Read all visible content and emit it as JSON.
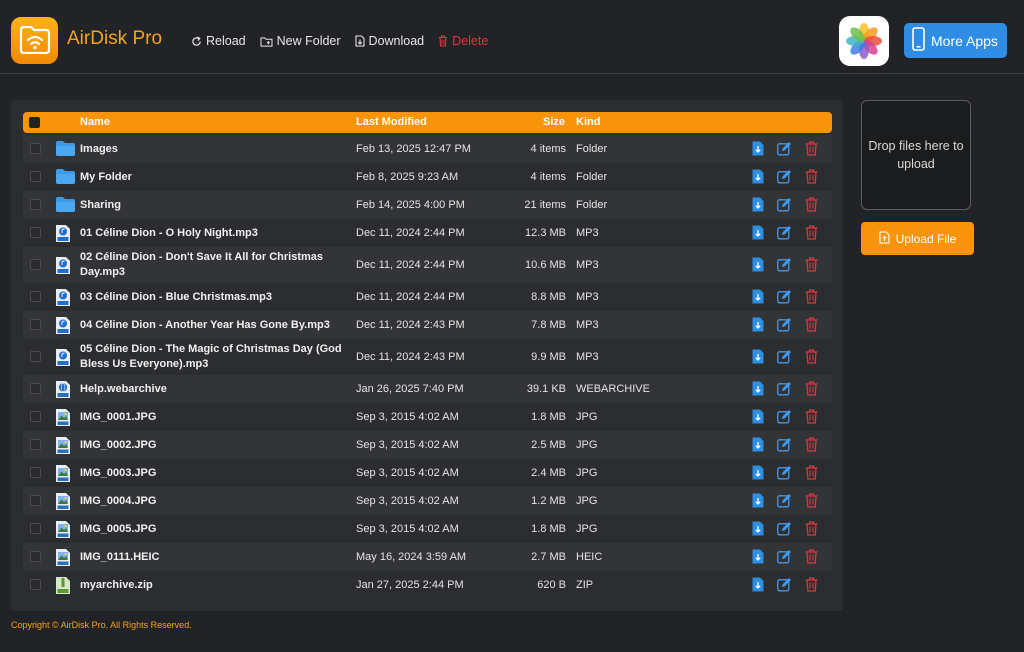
{
  "app": {
    "title": "AirDisk Pro"
  },
  "toolbar": {
    "reload": "Reload",
    "new_folder": "New Folder",
    "download": "Download",
    "delete": "Delete"
  },
  "more_apps": "More Apps",
  "table": {
    "headers": {
      "name": "Name",
      "modified": "Last Modified",
      "size": "Size",
      "kind": "Kind"
    },
    "rows": [
      {
        "name": "Images",
        "modified": "Feb 13, 2025 12:47 PM",
        "size": "4 items",
        "kind": "Folder",
        "icon": "folder-icon"
      },
      {
        "name": "My Folder",
        "modified": "Feb 8, 2025 9:23 AM",
        "size": "4 items",
        "kind": "Folder",
        "icon": "folder-icon"
      },
      {
        "name": "Sharing",
        "modified": "Feb 14, 2025 4:00 PM",
        "size": "21 items",
        "kind": "Folder",
        "icon": "folder-icon"
      },
      {
        "name": "01 Céline Dion - O Holy Night.mp3",
        "modified": "Dec 11, 2024 2:44 PM",
        "size": "12.3 MB",
        "kind": "MP3",
        "icon": "mp3-file-icon"
      },
      {
        "name": "02 Céline Dion - Don't Save It All for Christmas Day.mp3",
        "modified": "Dec 11, 2024 2:44 PM",
        "size": "10.6 MB",
        "kind": "MP3",
        "icon": "mp3-file-icon"
      },
      {
        "name": "03 Céline Dion - Blue Christmas.mp3",
        "modified": "Dec 11, 2024 2:44 PM",
        "size": "8.8 MB",
        "kind": "MP3",
        "icon": "mp3-file-icon"
      },
      {
        "name": "04 Céline Dion - Another Year Has Gone By.mp3",
        "modified": "Dec 11, 2024 2:43 PM",
        "size": "7.8 MB",
        "kind": "MP3",
        "icon": "mp3-file-icon"
      },
      {
        "name": "05 Céline Dion - The Magic of Christmas Day (God Bless Us Everyone).mp3",
        "modified": "Dec 11, 2024 2:43 PM",
        "size": "9.9 MB",
        "kind": "MP3",
        "icon": "mp3-file-icon"
      },
      {
        "name": "Help.webarchive",
        "modified": "Jan 26, 2025 7:40 PM",
        "size": "39.1 KB",
        "kind": "WEBARCHIVE",
        "icon": "webarchive-file-icon"
      },
      {
        "name": "IMG_0001.JPG",
        "modified": "Sep 3, 2015 4:02 AM",
        "size": "1.8 MB",
        "kind": "JPG",
        "icon": "image-file-icon"
      },
      {
        "name": "IMG_0002.JPG",
        "modified": "Sep 3, 2015 4:02 AM",
        "size": "2.5 MB",
        "kind": "JPG",
        "icon": "image-file-icon"
      },
      {
        "name": "IMG_0003.JPG",
        "modified": "Sep 3, 2015 4:02 AM",
        "size": "2.4 MB",
        "kind": "JPG",
        "icon": "image-file-icon"
      },
      {
        "name": "IMG_0004.JPG",
        "modified": "Sep 3, 2015 4:02 AM",
        "size": "1.2 MB",
        "kind": "JPG",
        "icon": "image-file-icon"
      },
      {
        "name": "IMG_0005.JPG",
        "modified": "Sep 3, 2015 4:02 AM",
        "size": "1.8 MB",
        "kind": "JPG",
        "icon": "image-file-icon"
      },
      {
        "name": "IMG_0111.HEIC",
        "modified": "May 16, 2024 3:59 AM",
        "size": "2.7 MB",
        "kind": "HEIC",
        "icon": "image-file-icon"
      },
      {
        "name": "myarchive.zip",
        "modified": "Jan 27, 2025 2:44 PM",
        "size": "620 B",
        "kind": "ZIP",
        "icon": "zip-file-icon"
      }
    ]
  },
  "dropzone": "Drop files here to upload",
  "upload_button": "Upload File",
  "footer": "Copyright © AirDisk Pro. All Rights Reserved.",
  "colors": {
    "accent": "#f7940c",
    "brand": "#f7a21d",
    "danger": "#d9393f",
    "blue": "#2f8de4"
  }
}
